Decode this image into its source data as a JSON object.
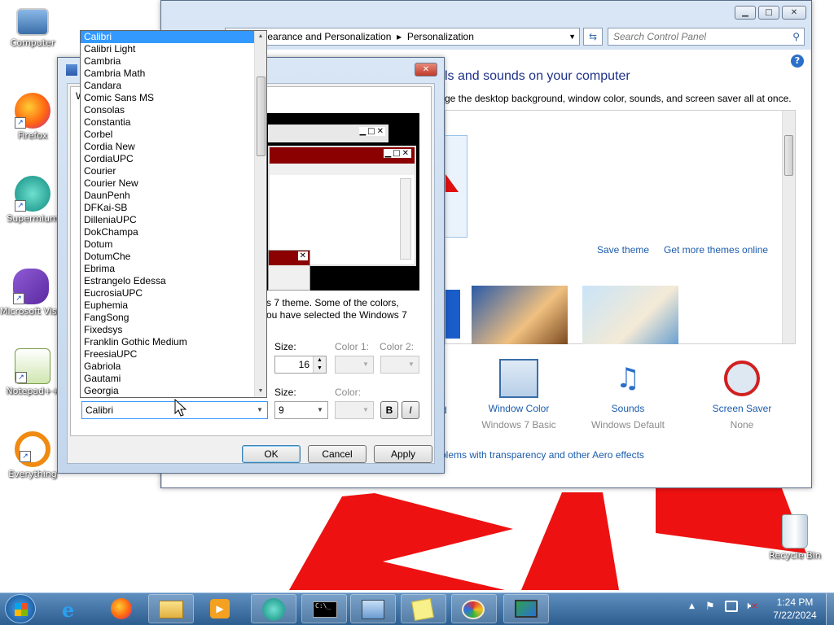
{
  "desktop": {
    "icons": [
      {
        "name": "computer-icon",
        "label": "Computer"
      },
      {
        "name": "firefox-icon",
        "label": "Firefox"
      },
      {
        "name": "supermium-icon",
        "label": "Supermium"
      },
      {
        "name": "visual-studio-icon",
        "label": "Microsoft Visual Studi..."
      },
      {
        "name": "notepadpp-icon",
        "label": "Notepad++"
      },
      {
        "name": "everything-icon",
        "label": "Everything"
      },
      {
        "name": "recycle-bin-icon",
        "label": "Recycle Bin"
      }
    ]
  },
  "control_panel": {
    "breadcrumb": [
      "Appearance and Personalization",
      "Personalization"
    ],
    "search_placeholder": "Search Control Panel",
    "heading": "Change the visuals and sounds on your computer",
    "heading_visible": "ls and sounds on your computer",
    "subtext": "ge the desktop background, window color, sounds, and screen saver all at once.",
    "save_theme": "Save theme",
    "get_more_themes": "Get more themes online",
    "partial_label": "d",
    "settings": [
      {
        "label": "Window Color",
        "value": "Windows 7 Basic"
      },
      {
        "label": "Sounds",
        "value": "Windows Default"
      },
      {
        "label": "Screen Saver",
        "value": "None"
      }
    ],
    "aero_link": "blems with transparency and other Aero effects"
  },
  "dialog": {
    "preview_text_1": "s 7 theme.  Some of the colors,",
    "preview_text_2": "ou have selected the Windows 7",
    "item_size_label": "Size:",
    "item_size_value": "16",
    "color1_label": "Color 1:",
    "color2_label": "Color 2:",
    "font_size_label": "Size:",
    "font_size_value": "9",
    "font_color_label": "Color:",
    "bold_label": "B",
    "italic_label": "I",
    "selected_font": "Calibri",
    "ok": "OK",
    "cancel": "Cancel",
    "apply": "Apply",
    "partial_w": "W"
  },
  "font_list": {
    "selected_index": 0,
    "items": [
      "Calibri",
      "Calibri Light",
      "Cambria",
      "Cambria Math",
      "Candara",
      "Comic Sans MS",
      "Consolas",
      "Constantia",
      "Corbel",
      "Cordia New",
      "CordiaUPC",
      "Courier",
      "Courier New",
      "DaunPenh",
      "DFKai-SB",
      "DilleniaUPC",
      "DokChampa",
      "Dotum",
      "DotumChe",
      "Ebrima",
      "Estrangelo Edessa",
      "EucrosiaUPC",
      "Euphemia",
      "FangSong",
      "Fixedsys",
      "Franklin Gothic Medium",
      "FreesiaUPC",
      "Gabriola",
      "Gautami",
      "Georgia"
    ]
  },
  "taskbar": {
    "time": "1:24 PM",
    "date": "7/22/2024"
  },
  "colors": {
    "taskbar_bg": "#2c5d8f",
    "selection": "#3399ff",
    "preview_caption_red": "#8b0000",
    "link_blue": "#1c5cad",
    "desktop_red": "#ee1111"
  }
}
